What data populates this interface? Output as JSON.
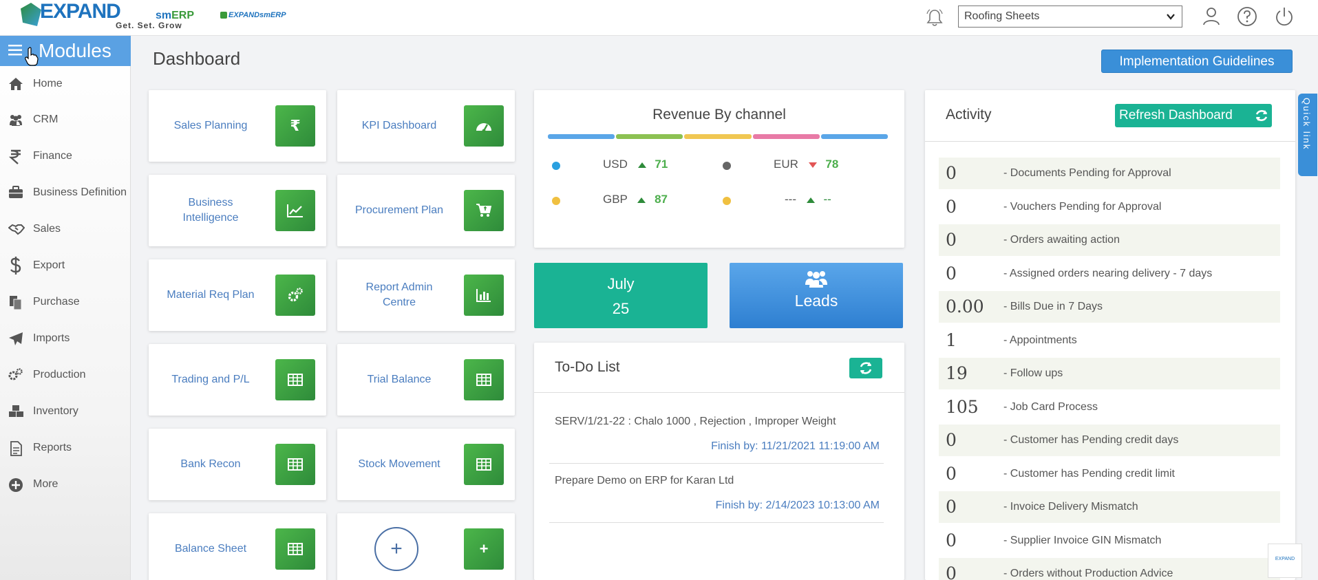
{
  "header": {
    "logo_text": "EXPAND",
    "logo_sm": "sm",
    "logo_erp": "ERP",
    "tagline": "Get. Set. Grow",
    "secondary_logo": "EXPANDsmERP",
    "company_selected": "Roofing Sheets"
  },
  "sidebar": {
    "title": "Modules",
    "items": [
      {
        "label": "Home",
        "icon": "home-icon"
      },
      {
        "label": "CRM",
        "icon": "users-icon"
      },
      {
        "label": "Finance",
        "icon": "rupee-icon"
      },
      {
        "label": "Business Definition",
        "icon": "briefcase-icon"
      },
      {
        "label": "Sales",
        "icon": "handshake-icon"
      },
      {
        "label": "Export",
        "icon": "dollar-icon"
      },
      {
        "label": "Purchase",
        "icon": "documents-icon"
      },
      {
        "label": "Imports",
        "icon": "plane-icon"
      },
      {
        "label": "Production",
        "icon": "gears-icon"
      },
      {
        "label": "Inventory",
        "icon": "boxes-icon"
      },
      {
        "label": "Reports",
        "icon": "report-icon"
      },
      {
        "label": "More",
        "icon": "plus-circle-icon"
      }
    ]
  },
  "main": {
    "title": "Dashboard",
    "implementation_button": "Implementation Guidelines"
  },
  "tiles": [
    {
      "label": "Sales Planning",
      "icon": "rupee-icon",
      "glyph": "₹"
    },
    {
      "label": "KPI Dashboard",
      "icon": "speedometer-icon",
      "glyph": ""
    },
    {
      "label": "Business Intelligence",
      "icon": "line-chart-icon",
      "glyph": ""
    },
    {
      "label": "Procurement Plan",
      "icon": "cart-icon",
      "glyph": ""
    },
    {
      "label": "Material Req Plan",
      "icon": "gears-icon",
      "glyph": ""
    },
    {
      "label": "Report Admin Centre",
      "icon": "bar-chart-icon",
      "glyph": ""
    },
    {
      "label": "Trading and P/L",
      "icon": "table-icon",
      "glyph": ""
    },
    {
      "label": "Trial Balance",
      "icon": "table-icon",
      "glyph": ""
    },
    {
      "label": "Bank Recon",
      "icon": "table-icon",
      "glyph": ""
    },
    {
      "label": "Stock Movement",
      "icon": "table-icon",
      "glyph": ""
    },
    {
      "label": "Balance Sheet",
      "icon": "table-icon",
      "glyph": ""
    },
    {
      "label": "",
      "icon": "plus-icon",
      "glyph": "+"
    }
  ],
  "revenue": {
    "title": "Revenue By channel",
    "bar_colors": [
      "#5aa6e8",
      "#8cc152",
      "#f0c752",
      "#e87aa6",
      "#5aa6e8"
    ],
    "channels": [
      {
        "name": "USD",
        "trend": "up",
        "value": "71",
        "dot": "#2aa0e0"
      },
      {
        "name": "EUR",
        "trend": "down",
        "value": "78",
        "dot": "#666666"
      },
      {
        "name": "GBP",
        "trend": "up",
        "value": "87",
        "dot": "#f0c040"
      },
      {
        "name": "---",
        "trend": "up",
        "value": "--",
        "dot": "#f0c040"
      }
    ]
  },
  "date_card": {
    "month": "July",
    "day": "25"
  },
  "leads_card": {
    "label": "Leads"
  },
  "todo": {
    "title": "To-Do List",
    "items": [
      {
        "text": "SERV/1/21-22 : Chalo 1000 , Rejection , Improper Weight",
        "finish": "Finish by: 11/21/2021 11:19:00 AM"
      },
      {
        "text": "Prepare Demo on ERP for Karan Ltd",
        "finish": "Finish by: 2/14/2023 10:13:00 AM"
      }
    ]
  },
  "activity": {
    "title": "Activity",
    "refresh_label": "Refresh Dashboard",
    "rows": [
      {
        "value": "0",
        "label": "- Documents Pending for Approval"
      },
      {
        "value": "0",
        "label": "- Vouchers Pending for Approval"
      },
      {
        "value": "0",
        "label": "- Orders awaiting action"
      },
      {
        "value": "0",
        "label": "- Assigned orders nearing delivery - 7 days"
      },
      {
        "value": "0.00",
        "label": "- Bills Due in 7 Days"
      },
      {
        "value": "1",
        "label": "- Appointments"
      },
      {
        "value": "19",
        "label": "- Follow ups"
      },
      {
        "value": "105",
        "label": "- Job Card Process"
      },
      {
        "value": "0",
        "label": "- Customer has Pending credit days"
      },
      {
        "value": "0",
        "label": "- Customer has Pending credit limit"
      },
      {
        "value": "0",
        "label": "- Invoice Delivery Mismatch"
      },
      {
        "value": "0",
        "label": "- Supplier Invoice GIN Mismatch"
      },
      {
        "value": "0",
        "label": "- Orders without Production Advice"
      }
    ]
  },
  "quick_link": {
    "label": "Quick link"
  },
  "corner_logo": {
    "text": "EXPAND"
  }
}
